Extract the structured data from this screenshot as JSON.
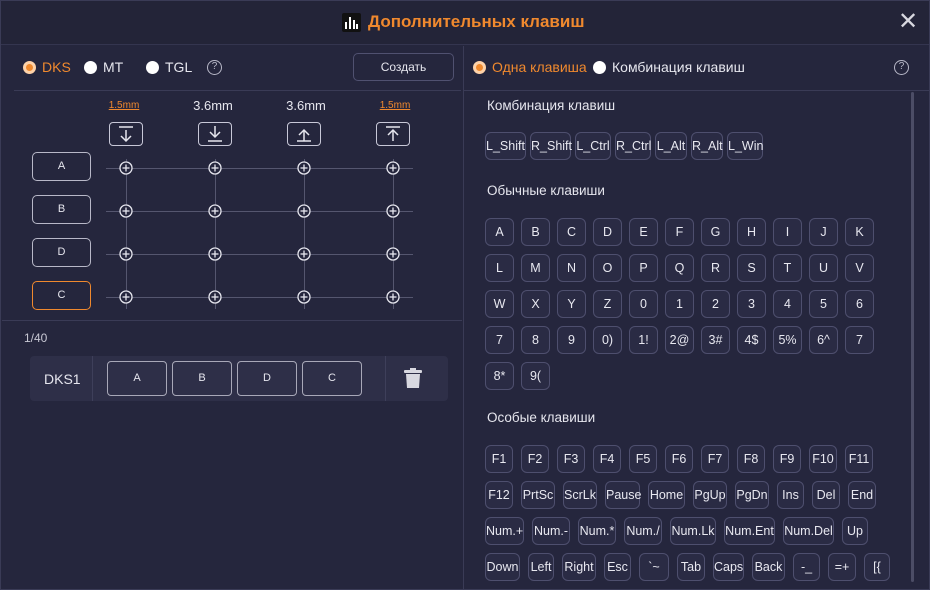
{
  "window": {
    "title": "Дополнительных клавиш",
    "close_label": "✕"
  },
  "left": {
    "modes": [
      {
        "label": "DKS",
        "active": true
      },
      {
        "label": "MT",
        "active": false
      },
      {
        "label": "TGL",
        "active": false
      }
    ],
    "help_label": "?",
    "create_label": "Создать",
    "distances": [
      "1.5mm",
      "3.6mm",
      "3.6mm",
      "1.5mm"
    ],
    "directions": [
      "press-down-bottom",
      "press-down",
      "release-up",
      "release-top"
    ],
    "keys": [
      "A",
      "B",
      "D",
      "C"
    ],
    "count": "1/40",
    "dks_entry": {
      "name": "DKS1",
      "keys": [
        "A",
        "B",
        "D",
        "C"
      ]
    }
  },
  "right": {
    "modes": [
      {
        "label": "Одна клавиша",
        "active": true
      },
      {
        "label": "Комбинация клавиш",
        "active": false
      }
    ],
    "help_label": "?",
    "combo_title": "Комбинация клавиш",
    "combo_keys": [
      "L_Shift",
      "R_Shift",
      "L_Ctrl",
      "R_Ctrl",
      "L_Alt",
      "R_Alt",
      "L_Win"
    ],
    "normal_title": "Обычные клавиши",
    "normal_keys": [
      [
        "A",
        "B",
        "C",
        "D",
        "E",
        "F",
        "G",
        "H",
        "I",
        "J",
        "K"
      ],
      [
        "L",
        "M",
        "N",
        "O",
        "P",
        "Q",
        "R",
        "S",
        "T",
        "U",
        "V"
      ],
      [
        "W",
        "X",
        "Y",
        "Z",
        "0",
        "1",
        "2",
        "3",
        "4",
        "5",
        "6"
      ],
      [
        "7",
        "8",
        "9",
        "0)",
        "1!",
        "2@",
        "3#",
        "4$",
        "5%",
        "6^",
        "7"
      ],
      [
        "8*",
        "9("
      ]
    ],
    "special_title": "Особые клавиши",
    "special_keys": [
      [
        "F1",
        "F2",
        "F3",
        "F4",
        "F5",
        "F6",
        "F7",
        "F8",
        "F9",
        "F10",
        "F11"
      ],
      [
        "F12",
        "PrtSc",
        "ScrLk",
        "Pause",
        "Home",
        "PgUp",
        "PgDn",
        "Ins",
        "Del",
        "End"
      ],
      [
        "Num.+",
        "Num.-",
        "Num.*",
        "Num./",
        "Num.Lk",
        "Num.Ent",
        "Num.Del",
        "Up"
      ],
      [
        "Down",
        "Left",
        "Right",
        "Esc",
        "`~",
        "Tab",
        "Caps",
        "Back",
        "-_",
        "=+",
        "[{"
      ]
    ]
  },
  "colors": {
    "accent": "#f0892e",
    "bg": "#25263d",
    "key_border": "#4e4f6e"
  }
}
